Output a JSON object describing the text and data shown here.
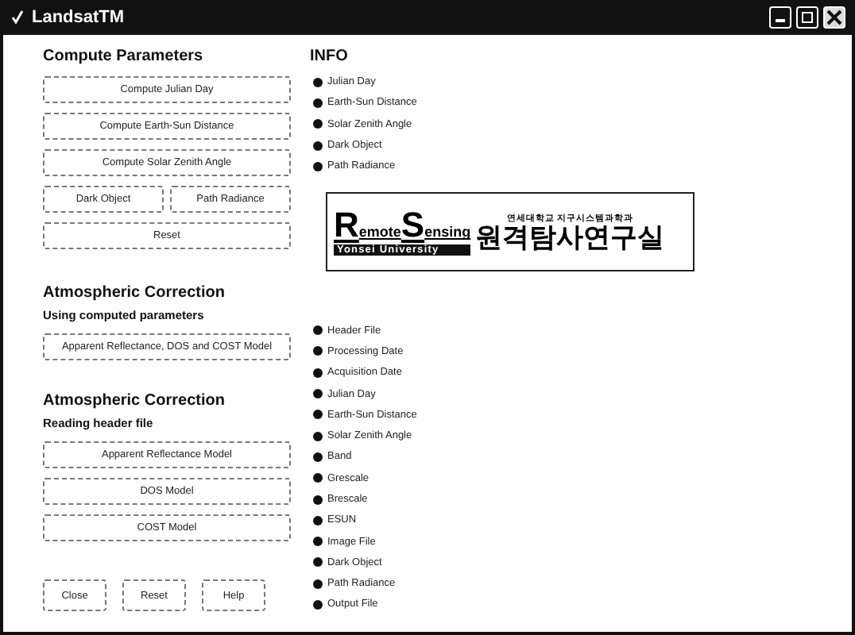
{
  "window": {
    "title": "LandsatTM"
  },
  "compute_parameters": {
    "heading": "Compute Parameters",
    "buttons": [
      [
        "Compute Julian Day"
      ],
      [
        "Compute Earth-Sun Distance"
      ],
      [
        "Compute Solar Zenith Angle"
      ],
      [
        "Dark Object",
        "Path Radiance"
      ],
      [
        "Reset"
      ]
    ]
  },
  "atmospheric_correction_computed": {
    "heading": "Atmospheric Correction",
    "subheading": "Using computed parameters",
    "buttons": [
      "Apparent Reflectance, DOS and COST Model"
    ]
  },
  "atmospheric_correction_header": {
    "heading": "Atmospheric Correction",
    "subheading": "Reading header file",
    "buttons": [
      "Apparent Reflectance Model",
      "DOS Model",
      "COST Model"
    ]
  },
  "bottom_buttons": [
    "Close",
    "Reset",
    "Help"
  ],
  "info": {
    "heading": "INFO",
    "items": [
      "Julian Day",
      "Earth-Sun Distance",
      "Solar Zenith Angle",
      "Dark Object",
      "Path Radiance"
    ]
  },
  "logo": {
    "initial_1": "R",
    "word_1": "emote",
    "initial_2": "S",
    "word_2": "ensing",
    "university": "Yonsei University",
    "department": "연세대학교 지구시스템과학과",
    "lab": "원격탐사연구실"
  },
  "header_info": {
    "items": [
      "Header File",
      "Processing Date",
      "Acquisition Date",
      "Julian Day",
      "Earth-Sun Distance",
      "Solar Zenith Angle",
      "Band",
      "Grescale",
      "Brescale",
      "ESUN",
      "Image File",
      "Dark Object",
      "Path Radiance",
      "Output File"
    ]
  }
}
